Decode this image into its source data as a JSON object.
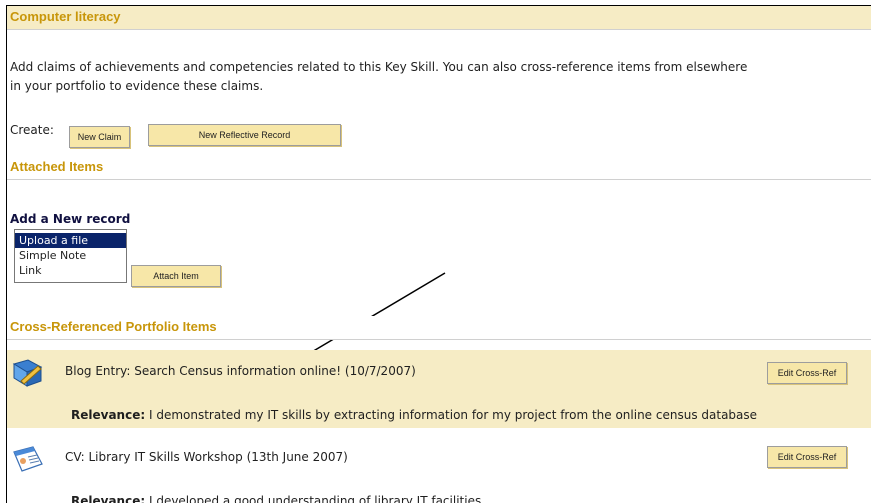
{
  "sections": {
    "literacy": "Computer literacy",
    "attached": "Attached Items",
    "cross_ref": "Cross-Referenced Portfolio Items"
  },
  "description_line1": "Add claims of achievements and competencies related to this Key Skill. You can also cross-reference items from elsewhere",
  "description_line2": "in your portfolio to evidence these claims.",
  "create": {
    "label": "Create:",
    "new_claim": "New Claim",
    "new_reflective": "New Reflective Record"
  },
  "add_record": {
    "title": "Add a New record",
    "options": [
      "Upload a file",
      "Simple Note",
      "Link"
    ],
    "selected": "Upload a file",
    "attach_button": "Attach Item"
  },
  "items": [
    {
      "title": "Blog Entry: Search Census information online! (10/7/2007)",
      "edit_label": "Edit Cross-Ref",
      "relevance_label": "Relevance:",
      "relevance_text": " I demonstrated my IT skills by extracting information for my project from the online census database"
    },
    {
      "title": "CV: Library IT Skills Workshop (13th June 2007)",
      "edit_label": "Edit Cross-Ref",
      "relevance_label": "Relevance:",
      "relevance_text": " I developed a good understanding of library IT facilities"
    }
  ],
  "colors": {
    "header_text": "#c8960a",
    "highlight_row": "#f6ecc5",
    "button_bg": "#f7e7a8",
    "selected_option": "#0a246a"
  }
}
